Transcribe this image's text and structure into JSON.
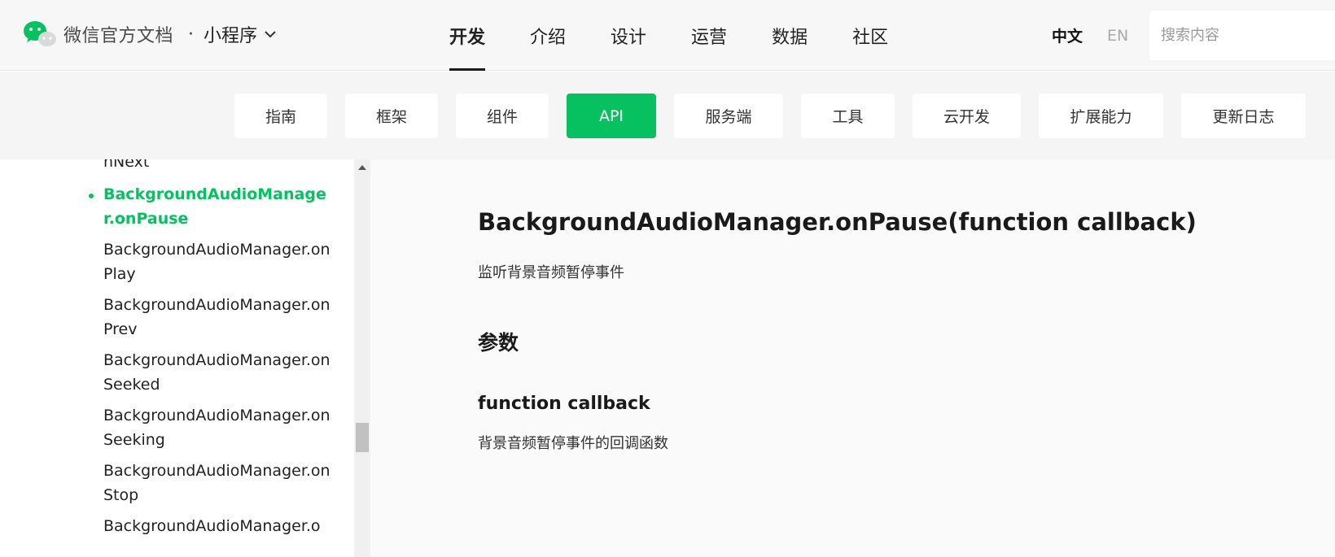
{
  "header": {
    "brand": "微信官方文档",
    "separator": "·",
    "product": "小程序",
    "nav": [
      {
        "label": "开发",
        "active": true
      },
      {
        "label": "介绍",
        "active": false
      },
      {
        "label": "设计",
        "active": false
      },
      {
        "label": "运营",
        "active": false
      },
      {
        "label": "数据",
        "active": false
      },
      {
        "label": "社区",
        "active": false
      }
    ],
    "lang_zh": "中文",
    "lang_en": "EN",
    "search_placeholder": "搜索内容"
  },
  "subnav": [
    {
      "label": "指南",
      "active": false
    },
    {
      "label": "框架",
      "active": false
    },
    {
      "label": "组件",
      "active": false
    },
    {
      "label": "API",
      "active": true
    },
    {
      "label": "服务端",
      "active": false
    },
    {
      "label": "工具",
      "active": false
    },
    {
      "label": "云开发",
      "active": false
    },
    {
      "label": "扩展能力",
      "active": false
    },
    {
      "label": "更新日志",
      "active": false
    }
  ],
  "sidebar": {
    "items": [
      {
        "label": "nNext",
        "active": false
      },
      {
        "label": "BackgroundAudioManager.onPause",
        "active": true
      },
      {
        "label": "BackgroundAudioManager.onPlay",
        "active": false
      },
      {
        "label": "BackgroundAudioManager.onPrev",
        "active": false
      },
      {
        "label": "BackgroundAudioManager.onSeeked",
        "active": false
      },
      {
        "label": "BackgroundAudioManager.onSeeking",
        "active": false
      },
      {
        "label": "BackgroundAudioManager.onStop",
        "active": false
      },
      {
        "label": "BackgroundAudioManager.o",
        "active": false
      }
    ]
  },
  "content": {
    "title": "BackgroundAudioManager.onPause(function callback)",
    "description": "监听背景音频暂停事件",
    "params_heading": "参数",
    "param_name": "function callback",
    "param_description": "背景音频暂停事件的回调函数"
  },
  "colors": {
    "accent": "#07c160",
    "header_bg": "#f7f7f7",
    "subbar_bg": "#f5f5f5",
    "content_bg": "#fafafa"
  }
}
